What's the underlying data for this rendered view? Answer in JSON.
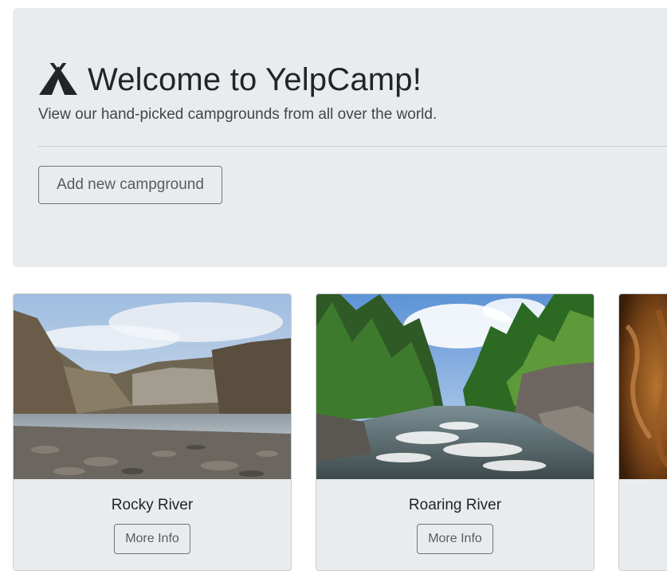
{
  "hero": {
    "icon": "tent-icon",
    "title": "Welcome to YelpCamp!",
    "lead": "View our hand-picked campgrounds from all over the world.",
    "add_button_label": "Add new campground"
  },
  "campgrounds": [
    {
      "name": "Rocky River",
      "button_label": "More Info",
      "image": "rocky-river-photo"
    },
    {
      "name": "Roaring River",
      "button_label": "More Info",
      "image": "roaring-river-photo"
    },
    {
      "name": "",
      "button_label": "",
      "image": "cave-photo"
    }
  ],
  "colors": {
    "jumbotron_bg": "#e9ecef",
    "card_bg": "#e9ecef",
    "button_border": "#6c757d",
    "text": "#212529"
  }
}
